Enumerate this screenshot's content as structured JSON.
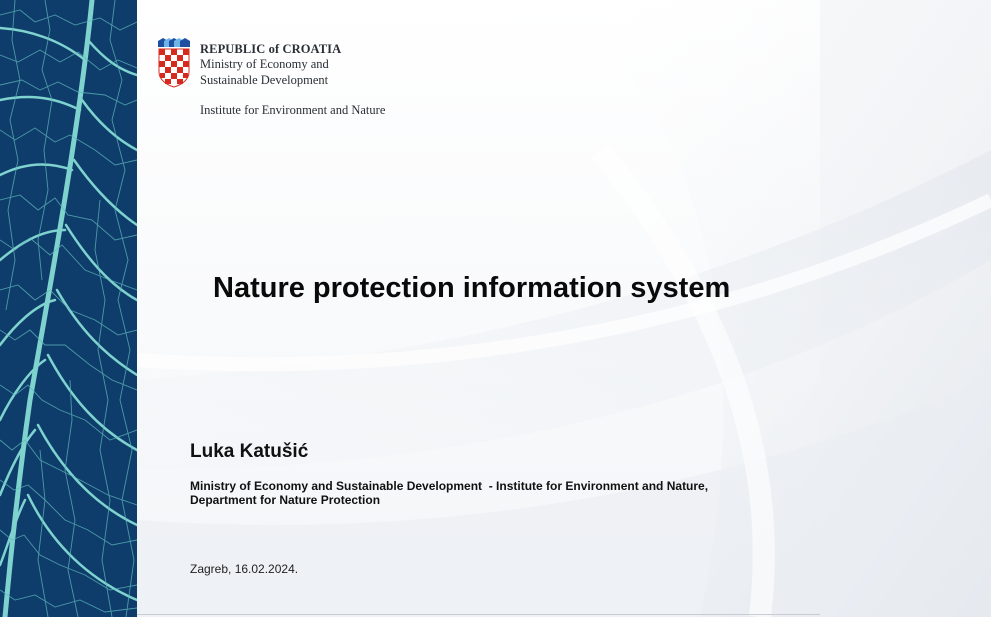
{
  "header": {
    "republic": "REPUBLIC of CROATIA",
    "ministry_line1": "Ministry of Economy and",
    "ministry_line2": "Sustainable Development",
    "institute": "Institute for Environment and Nature"
  },
  "slide": {
    "title": "Nature protection information system",
    "author": "Luka Katušić",
    "affiliation_line1": "Ministry of Economy and Sustainable Development  - Institute for Environment and Nature,",
    "affiliation_line2": "Department for Nature Protection",
    "place_date": "Zagreb, 16.02.2024."
  },
  "colors": {
    "leaf_panel": "#0f3d6b",
    "leaf_veins": "#7fd3cf",
    "coat_red": "#d52b1e",
    "coat_blue": "#1f4fa0"
  },
  "icons": {
    "logo": "croatian-coat-of-arms-icon"
  }
}
